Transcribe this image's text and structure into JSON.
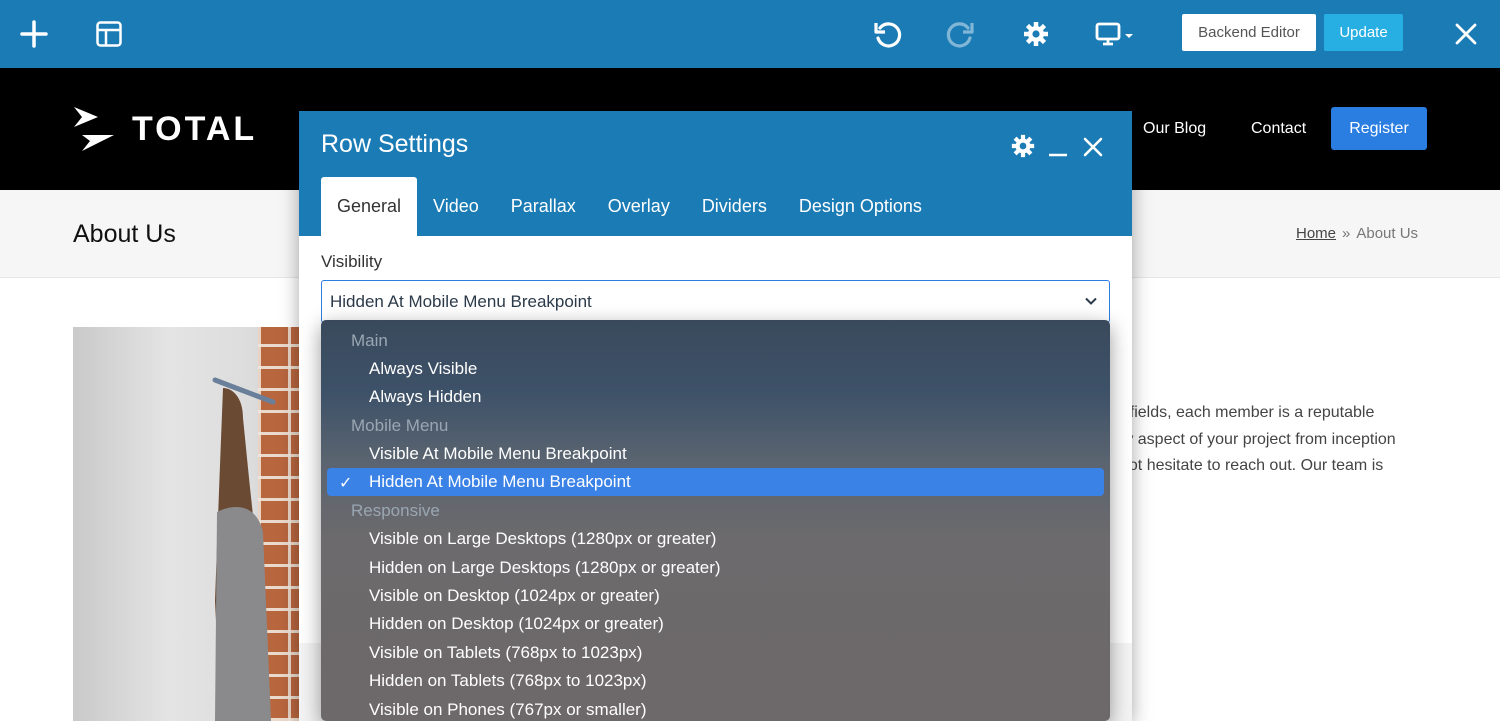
{
  "toolbar": {
    "add_icon": "plus-icon",
    "layout_icon": "layout-icon",
    "undo_icon": "undo-icon",
    "redo_icon": "redo-icon",
    "settings_icon": "gear-icon",
    "device_icon": "desktop-device-icon",
    "backend_editor_label": "Backend Editor",
    "update_label": "Update",
    "close_icon": "close-icon",
    "color": "#1b7bb5"
  },
  "site_header": {
    "logo_text": "TOTAL",
    "nav": [
      "Our Blog",
      "Contact"
    ],
    "register_label": "Register",
    "accent": "#2a7de1"
  },
  "page": {
    "title": "About Us",
    "breadcrumb_home": "Home",
    "breadcrumb_separator": "»",
    "breadcrumb_current": "About Us",
    "body_lines": [
      "r fields, each member is a reputable",
      "ry aspect of your project from inception",
      "not hesitate to reach out. Our team is"
    ]
  },
  "modal": {
    "title": "Row Settings",
    "tabs": [
      "General",
      "Video",
      "Parallax",
      "Overlay",
      "Dividers",
      "Design Options"
    ],
    "active_tab": "General",
    "field_label": "Visibility",
    "selected_value": "Hidden At Mobile Menu Breakpoint"
  },
  "dropdown": {
    "groups": [
      {
        "label": "Main",
        "options": [
          "Always Visible",
          "Always Hidden"
        ]
      },
      {
        "label": "Mobile Menu",
        "options": [
          "Visible At Mobile Menu Breakpoint",
          "Hidden At Mobile Menu Breakpoint"
        ]
      },
      {
        "label": "Responsive",
        "options": [
          "Visible on Large Desktops (1280px or greater)",
          "Hidden on Large Desktops (1280px or greater)",
          "Visible on Desktop (1024px or greater)",
          "Hidden on Desktop (1024px or greater)",
          "Visible on Tablets (768px to 1023px)",
          "Hidden on Tablets (768px to 1023px)",
          "Visible on Phones (767px or smaller)"
        ]
      }
    ],
    "selected_check": "✓",
    "highlight_color": "#3b82e6"
  }
}
